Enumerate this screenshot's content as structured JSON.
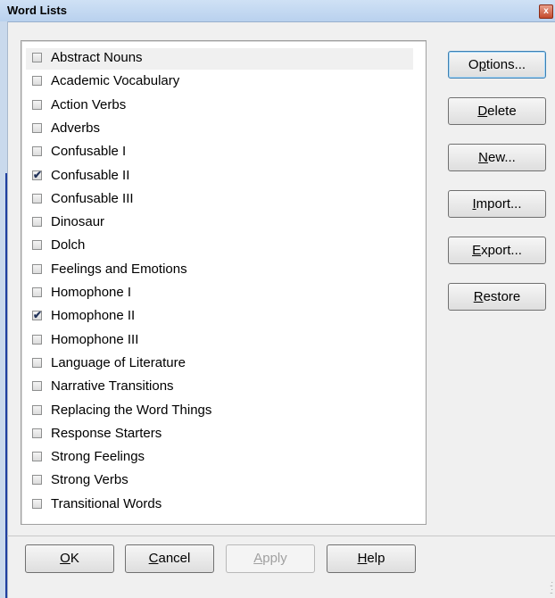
{
  "window": {
    "title": "Word Lists",
    "close_glyph": "x"
  },
  "list": {
    "items": [
      {
        "label": "Abstract Nouns",
        "checked": false,
        "highlighted": true
      },
      {
        "label": "Academic Vocabulary",
        "checked": false
      },
      {
        "label": "Action Verbs",
        "checked": false
      },
      {
        "label": "Adverbs",
        "checked": false
      },
      {
        "label": "Confusable I",
        "checked": false
      },
      {
        "label": "Confusable II",
        "checked": true
      },
      {
        "label": "Confusable III",
        "checked": false
      },
      {
        "label": "Dinosaur",
        "checked": false
      },
      {
        "label": "Dolch",
        "checked": false
      },
      {
        "label": "Feelings and Emotions",
        "checked": false
      },
      {
        "label": "Homophone I",
        "checked": false
      },
      {
        "label": "Homophone II",
        "checked": true
      },
      {
        "label": "Homophone III",
        "checked": false
      },
      {
        "label": "Language of Literature",
        "checked": false
      },
      {
        "label": "Narrative Transitions",
        "checked": false
      },
      {
        "label": "Replacing the Word Things",
        "checked": false
      },
      {
        "label": "Response Starters",
        "checked": false
      },
      {
        "label": "Strong Feelings",
        "checked": false
      },
      {
        "label": "Strong Verbs",
        "checked": false
      },
      {
        "label": "Transitional Words",
        "checked": false
      }
    ]
  },
  "side_buttons": [
    {
      "name": "options-button",
      "label": "Options...",
      "accel": "p",
      "focused": true
    },
    {
      "name": "delete-button",
      "label": "Delete",
      "accel": "D"
    },
    {
      "name": "new-button",
      "label": "New...",
      "accel": "N"
    },
    {
      "name": "import-button",
      "label": "Import...",
      "accel": "I"
    },
    {
      "name": "export-button",
      "label": "Export...",
      "accel": "E"
    },
    {
      "name": "restore-button",
      "label": "Restore",
      "accel": "R"
    }
  ],
  "bottom_buttons": [
    {
      "name": "ok-button",
      "label": "OK",
      "accel": "O",
      "enabled": true
    },
    {
      "name": "cancel-button",
      "label": "Cancel",
      "accel": "C",
      "enabled": true
    },
    {
      "name": "apply-button",
      "label": "Apply",
      "accel": "A",
      "enabled": false
    },
    {
      "name": "help-button",
      "label": "Help",
      "accel": "H",
      "enabled": true
    }
  ],
  "icons": {
    "check": "check-icon",
    "close": "close-icon",
    "grip": "resize-grip-icon"
  }
}
